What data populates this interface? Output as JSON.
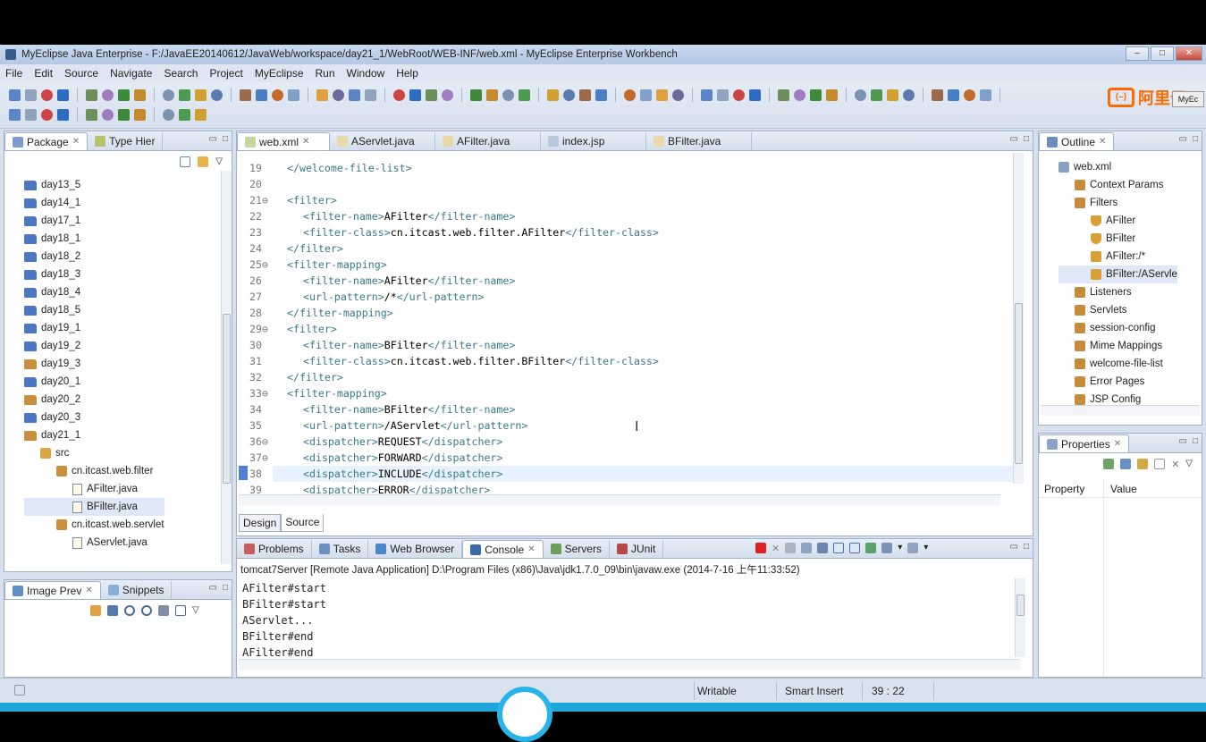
{
  "window": {
    "title": "MyEclipse Java Enterprise - F:/JavaEE20140612/JavaWeb/workspace/day21_1/WebRoot/WEB-INF/web.xml - MyEclipse Enterprise Workbench",
    "min": "‒",
    "max": "□",
    "close": "✕"
  },
  "menu": [
    "File",
    "Edit",
    "Source",
    "Navigate",
    "Search",
    "Project",
    "MyEclipse",
    "Run",
    "Window",
    "Help"
  ],
  "logo": {
    "text": "阿里云",
    "badge": "MyEc"
  },
  "package_explorer": {
    "tabs": [
      "Package",
      "Type Hier"
    ],
    "items": [
      {
        "label": "day13_5",
        "type": "folder",
        "indent": 0
      },
      {
        "label": "day14_1",
        "type": "folder",
        "indent": 0
      },
      {
        "label": "day17_1",
        "type": "folder",
        "indent": 0
      },
      {
        "label": "day18_1",
        "type": "folder",
        "indent": 0
      },
      {
        "label": "day18_2",
        "type": "folder",
        "indent": 0
      },
      {
        "label": "day18_3",
        "type": "folder",
        "indent": 0
      },
      {
        "label": "day18_4",
        "type": "folder",
        "indent": 0
      },
      {
        "label": "day18_5",
        "type": "folder",
        "indent": 0
      },
      {
        "label": "day19_1",
        "type": "folder",
        "indent": 0
      },
      {
        "label": "day19_2",
        "type": "folder",
        "indent": 0
      },
      {
        "label": "day19_3",
        "type": "project",
        "indent": 0
      },
      {
        "label": "day20_1",
        "type": "folder",
        "indent": 0
      },
      {
        "label": "day20_2",
        "type": "project",
        "indent": 0
      },
      {
        "label": "day20_3",
        "type": "folder",
        "indent": 0
      },
      {
        "label": "day21_1",
        "type": "project",
        "indent": 0
      },
      {
        "label": "src",
        "type": "src",
        "indent": 1
      },
      {
        "label": "cn.itcast.web.filter",
        "type": "package",
        "indent": 2
      },
      {
        "label": "AFilter.java",
        "type": "java",
        "indent": 3
      },
      {
        "label": "BFilter.java",
        "type": "java",
        "indent": 3
      },
      {
        "label": "cn.itcast.web.servlet",
        "type": "package",
        "indent": 2
      },
      {
        "label": "AServlet.java",
        "type": "java",
        "indent": 3
      }
    ]
  },
  "image_preview": {
    "tabs": [
      "Image Prev",
      "Snippets"
    ]
  },
  "editor": {
    "tabs": [
      "web.xml",
      "AServlet.java",
      "AFilter.java",
      "index.jsp",
      "BFilter.java"
    ],
    "line_numbers": [
      "19",
      "20",
      "21⊖",
      "22",
      "23",
      "24",
      "25⊖",
      "26",
      "27",
      "28",
      "29⊖",
      "30",
      "31",
      "32",
      "33⊖",
      "34",
      "35",
      "36⊖",
      "37⊖",
      "38",
      "39"
    ],
    "lines": [
      {
        "indent": 0,
        "open": "</welcome-file-list>",
        "text": "",
        "close": ""
      },
      {
        "indent": 0,
        "open": "",
        "text": "",
        "close": ""
      },
      {
        "indent": 0,
        "open": "<filter>",
        "text": "",
        "close": ""
      },
      {
        "indent": 1,
        "open": "<filter-name>",
        "text": "AFilter",
        "close": "</filter-name>"
      },
      {
        "indent": 1,
        "open": "<filter-class>",
        "text": "cn.itcast.web.filter.AFilter",
        "close": "</filter-class>"
      },
      {
        "indent": 0,
        "open": "</filter>",
        "text": "",
        "close": ""
      },
      {
        "indent": 0,
        "open": "<filter-mapping>",
        "text": "",
        "close": ""
      },
      {
        "indent": 1,
        "open": "<filter-name>",
        "text": "AFilter",
        "close": "</filter-name>"
      },
      {
        "indent": 1,
        "open": "<url-pattern>",
        "text": "/*",
        "close": "</url-pattern>"
      },
      {
        "indent": 0,
        "open": "</filter-mapping>",
        "text": "",
        "close": ""
      },
      {
        "indent": 0,
        "open": "<filter>",
        "text": "",
        "close": ""
      },
      {
        "indent": 1,
        "open": "<filter-name>",
        "text": "BFilter",
        "close": "</filter-name>"
      },
      {
        "indent": 1,
        "open": "<filter-class>",
        "text": "cn.itcast.web.filter.BFilter",
        "close": "</filter-class>"
      },
      {
        "indent": 0,
        "open": "</filter>",
        "text": "",
        "close": ""
      },
      {
        "indent": 0,
        "open": "<filter-mapping>",
        "text": "",
        "close": ""
      },
      {
        "indent": 1,
        "open": "<filter-name>",
        "text": "BFilter",
        "close": "</filter-name>"
      },
      {
        "indent": 1,
        "open": "<url-pattern>",
        "text": "/AServlet",
        "close": "</url-pattern>"
      },
      {
        "indent": 1,
        "open": "<dispatcher>",
        "text": "REQUEST",
        "close": "</dispatcher>"
      },
      {
        "indent": 1,
        "open": "<dispatcher>",
        "text": "FORWARD",
        "close": "</dispatcher>"
      },
      {
        "indent": 1,
        "open": "<dispatcher>",
        "text": "INCLUDE",
        "close": "</dispatcher>"
      },
      {
        "indent": 1,
        "open": "<dispatcher>",
        "text": "ERROR",
        "close": "</dispatcher>"
      }
    ],
    "bottom_tabs": [
      "Design",
      "Source"
    ]
  },
  "outline": {
    "tab": "Outline",
    "items": [
      {
        "label": "web.xml",
        "indent": 0
      },
      {
        "label": "Context Params",
        "indent": 1
      },
      {
        "label": "Filters",
        "indent": 1
      },
      {
        "label": "AFilter",
        "indent": 2
      },
      {
        "label": "BFilter",
        "indent": 2
      },
      {
        "label": "AFilter:/*",
        "indent": 2
      },
      {
        "label": "BFilter:/AServle",
        "indent": 2
      },
      {
        "label": "Listeners",
        "indent": 1
      },
      {
        "label": "Servlets",
        "indent": 1
      },
      {
        "label": "session-config",
        "indent": 1
      },
      {
        "label": "Mime Mappings",
        "indent": 1
      },
      {
        "label": "welcome-file-list",
        "indent": 1
      },
      {
        "label": "Error Pages",
        "indent": 1
      },
      {
        "label": "JSP Config",
        "indent": 1
      }
    ]
  },
  "properties": {
    "tab": "Properties",
    "col_property": "Property",
    "col_value": "Value"
  },
  "console": {
    "tabs": [
      "Problems",
      "Tasks",
      "Web Browser",
      "Console",
      "Servers",
      "JUnit"
    ],
    "header": "tomcat7Server [Remote Java Application] D:\\Program Files (x86)\\Java\\jdk1.7.0_09\\bin\\javaw.exe (2014-7-16 上午11:33:52)",
    "lines": [
      "AFilter#start",
      "BFilter#start",
      "AServlet...",
      "BFilter#end",
      "AFilter#end"
    ]
  },
  "status": {
    "writable": "Writable",
    "insert": "Smart Insert",
    "position": "39 : 22"
  }
}
